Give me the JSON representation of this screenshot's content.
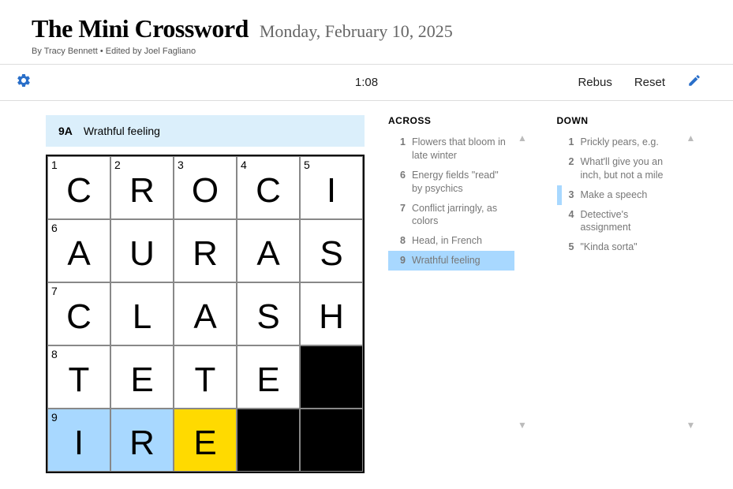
{
  "header": {
    "title": "The Mini Crossword",
    "date": "Monday, February 10, 2025",
    "byline": "By Tracy Bennett  •  Edited by Joel Fagliano"
  },
  "toolbar": {
    "timer": "1:08",
    "rebus_label": "Rebus",
    "reset_label": "Reset"
  },
  "cluebar": {
    "num": "9A",
    "text": "Wrathful feeling"
  },
  "grid": {
    "size": 5,
    "cells": [
      {
        "n": "1",
        "l": "C"
      },
      {
        "n": "2",
        "l": "R"
      },
      {
        "n": "3",
        "l": "O"
      },
      {
        "n": "4",
        "l": "C"
      },
      {
        "n": "5",
        "l": "I"
      },
      {
        "n": "6",
        "l": "A"
      },
      {
        "l": "U"
      },
      {
        "l": "R"
      },
      {
        "l": "A"
      },
      {
        "l": "S"
      },
      {
        "n": "7",
        "l": "C"
      },
      {
        "l": "L"
      },
      {
        "l": "A"
      },
      {
        "l": "S"
      },
      {
        "l": "H"
      },
      {
        "n": "8",
        "l": "T"
      },
      {
        "l": "E"
      },
      {
        "l": "T"
      },
      {
        "l": "E"
      },
      {
        "black": true
      },
      {
        "n": "9",
        "l": "I",
        "hl": true
      },
      {
        "l": "R",
        "hl": true
      },
      {
        "l": "E",
        "focus": true
      },
      {
        "black": true
      },
      {
        "black": true
      }
    ]
  },
  "clues": {
    "across": {
      "heading": "ACROSS",
      "items": [
        {
          "n": "1",
          "t": "Flowers that bloom in late winter"
        },
        {
          "n": "6",
          "t": "Energy fields \"read\" by psychics"
        },
        {
          "n": "7",
          "t": "Conflict jarringly, as colors"
        },
        {
          "n": "8",
          "t": "Head, in French"
        },
        {
          "n": "9",
          "t": "Wrathful feeling",
          "active": true
        }
      ]
    },
    "down": {
      "heading": "DOWN",
      "items": [
        {
          "n": "1",
          "t": "Prickly pears, e.g."
        },
        {
          "n": "2",
          "t": "What'll give you an inch, but not a mile"
        },
        {
          "n": "3",
          "t": "Make a speech",
          "related": true
        },
        {
          "n": "4",
          "t": "Detective's assignment"
        },
        {
          "n": "5",
          "t": "\"Kinda sorta\""
        }
      ]
    }
  }
}
